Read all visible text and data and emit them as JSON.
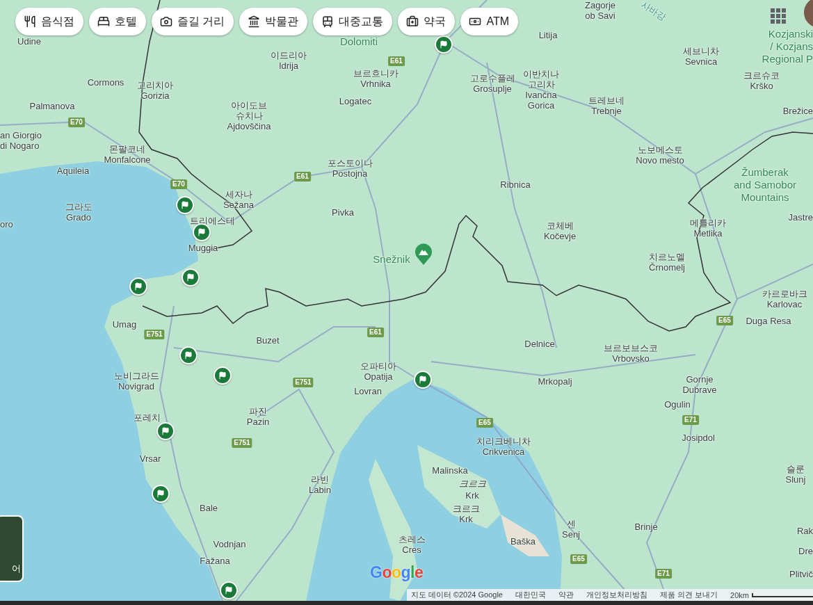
{
  "chips": [
    {
      "kind": "restaurant",
      "label": "음식점"
    },
    {
      "kind": "hotel",
      "label": "호텔"
    },
    {
      "kind": "sights",
      "label": "즐길 거리"
    },
    {
      "kind": "museum",
      "label": "박물관"
    },
    {
      "kind": "transit",
      "label": "대중교통"
    },
    {
      "kind": "pharmacy",
      "label": "약국"
    },
    {
      "kind": "atm",
      "label": "ATM"
    }
  ],
  "map": {
    "places": [
      {
        "kind": "town",
        "lines": [
          "Udine"
        ]
      },
      {
        "kind": "town",
        "lines": [
          "Cormons"
        ]
      },
      {
        "kind": "town",
        "lines": [
          "고리치아",
          "Gorizia"
        ]
      },
      {
        "kind": "town",
        "lines": [
          "Palmanova"
        ]
      },
      {
        "kind": "town",
        "lines": [
          "an Giorgio",
          "di Nogaro"
        ]
      },
      {
        "kind": "town",
        "lines": [
          "몬팔코네",
          "Monfalcone"
        ]
      },
      {
        "kind": "town",
        "lines": [
          "Aquileia"
        ]
      },
      {
        "kind": "town",
        "lines": [
          "그라도",
          "Grado"
        ]
      },
      {
        "kind": "town",
        "lines": [
          "oro"
        ]
      },
      {
        "kind": "town",
        "lines": [
          "세자나",
          "Sežana"
        ]
      },
      {
        "kind": "town",
        "lines": [
          "트리에스테"
        ]
      },
      {
        "kind": "town",
        "lines": [
          "Muggia"
        ]
      },
      {
        "kind": "town",
        "lines": [
          "Umag"
        ]
      },
      {
        "kind": "town",
        "lines": [
          "노비그라드",
          "Novigrad"
        ]
      },
      {
        "kind": "town",
        "lines": [
          "포레치"
        ]
      },
      {
        "kind": "town",
        "lines": [
          "Vrsar"
        ]
      },
      {
        "kind": "town",
        "lines": [
          "Bale"
        ]
      },
      {
        "kind": "town",
        "lines": [
          "Vodnjan"
        ]
      },
      {
        "kind": "town",
        "lines": [
          "Fažana"
        ]
      },
      {
        "kind": "town",
        "lines": [
          "파진",
          "Pazin"
        ]
      },
      {
        "kind": "town",
        "lines": [
          "라빈",
          "Labin"
        ]
      },
      {
        "kind": "town",
        "lines": [
          "Buzet"
        ]
      },
      {
        "kind": "town",
        "lines": [
          "오파티아",
          "Opatija"
        ]
      },
      {
        "kind": "town",
        "lines": [
          "Lovran"
        ]
      },
      {
        "kind": "town",
        "lines": [
          "이드리아",
          "Idrija"
        ]
      },
      {
        "kind": "town",
        "lines": [
          "브르흐니카",
          "Vrhnika"
        ]
      },
      {
        "kind": "town",
        "lines": [
          "Logatec"
        ]
      },
      {
        "kind": "town",
        "lines": [
          "아이도브",
          "슈치나",
          "Ajdovščina"
        ]
      },
      {
        "kind": "town",
        "lines": [
          "포스토이나",
          "Postojna"
        ]
      },
      {
        "kind": "town",
        "lines": [
          "Pivka"
        ]
      },
      {
        "kind": "town",
        "lines": [
          "Litija"
        ]
      },
      {
        "kind": "town",
        "lines": [
          "Zagorje",
          "ob Savi"
        ]
      },
      {
        "kind": "town",
        "lines": [
          "고로수플레",
          "Grosuplje"
        ]
      },
      {
        "kind": "town",
        "lines": [
          "이반치나",
          "고리차",
          "Ivančna",
          "Gorica"
        ]
      },
      {
        "kind": "town",
        "lines": [
          "트레브네",
          "Trebnje"
        ]
      },
      {
        "kind": "town",
        "lines": [
          "세브니차",
          "Sevnica"
        ]
      },
      {
        "kind": "town",
        "lines": [
          "크르슈코",
          "Krško"
        ]
      },
      {
        "kind": "town",
        "lines": [
          "Brežice"
        ]
      },
      {
        "kind": "town",
        "lines": [
          "노보메스토",
          "Novo mesto"
        ]
      },
      {
        "kind": "town",
        "lines": [
          "Ribnica"
        ]
      },
      {
        "kind": "town",
        "lines": [
          "코체베",
          "Kočevje"
        ]
      },
      {
        "kind": "town",
        "lines": [
          "메틀리카",
          "Metlika"
        ]
      },
      {
        "kind": "town",
        "lines": [
          "치르노멜",
          "Črnomelj"
        ]
      },
      {
        "kind": "town",
        "lines": [
          "카르로바크",
          "Karlovac"
        ]
      },
      {
        "kind": "town",
        "lines": [
          "Duga Resa"
        ]
      },
      {
        "kind": "town",
        "lines": [
          "Delnice"
        ]
      },
      {
        "kind": "town",
        "lines": [
          "브르보브스코",
          "Vrbovsko"
        ]
      },
      {
        "kind": "town",
        "lines": [
          "Mrkopalj"
        ]
      },
      {
        "kind": "town",
        "lines": [
          "Gornje",
          "Dubrave"
        ]
      },
      {
        "kind": "town",
        "lines": [
          "Ogulin"
        ]
      },
      {
        "kind": "town",
        "lines": [
          "Josipdol"
        ]
      },
      {
        "kind": "town",
        "lines": [
          "치리크베니차",
          "Crikvenica"
        ]
      },
      {
        "kind": "town",
        "lines": [
          "Malinska"
        ]
      },
      {
        "kind": "island",
        "lines": [
          "크르크"
        ]
      },
      {
        "kind": "town",
        "lines": [
          "Krk"
        ]
      },
      {
        "kind": "town",
        "lines": [
          "크르크",
          "Krk"
        ]
      },
      {
        "kind": "town",
        "lines": [
          "센",
          "Senj"
        ]
      },
      {
        "kind": "town",
        "lines": [
          "Brinje"
        ]
      },
      {
        "kind": "town",
        "lines": [
          "츠레스",
          "Cres"
        ]
      },
      {
        "kind": "town",
        "lines": [
          "Baška"
        ]
      },
      {
        "kind": "town",
        "lines": [
          "Jastre"
        ]
      },
      {
        "kind": "town",
        "lines": [
          "슬룬",
          "Slunj"
        ]
      },
      {
        "kind": "town",
        "lines": [
          "Rak"
        ]
      },
      {
        "kind": "town",
        "lines": [
          "Dre"
        ]
      },
      {
        "kind": "town",
        "lines": [
          "Plitvič"
        ]
      },
      {
        "kind": "nature",
        "lines": [
          "Dolomiti"
        ]
      },
      {
        "kind": "nature",
        "lines": [
          "Snežnik"
        ]
      },
      {
        "kind": "nature",
        "lines": [
          "Kozjanski",
          "/ Kozjans",
          "Regional P"
        ]
      },
      {
        "kind": "nature",
        "lines": [
          "Žumberak",
          "and Samobor",
          "Mountains"
        ]
      },
      {
        "kind": "river",
        "lines": [
          "사바강"
        ]
      }
    ],
    "roads": [
      "E61",
      "E70",
      "E70",
      "E61",
      "E751",
      "E61",
      "E751",
      "E751",
      "E65",
      "E65",
      "E71",
      "E65",
      "E71"
    ],
    "logo": "Google",
    "layer_label": "어"
  },
  "footer": {
    "links": [
      "지도 데이터 ©2024 Google",
      "대한민국",
      "약관",
      "개인정보처리방침",
      "제품 의견 보내기"
    ],
    "scale": "20km"
  }
}
